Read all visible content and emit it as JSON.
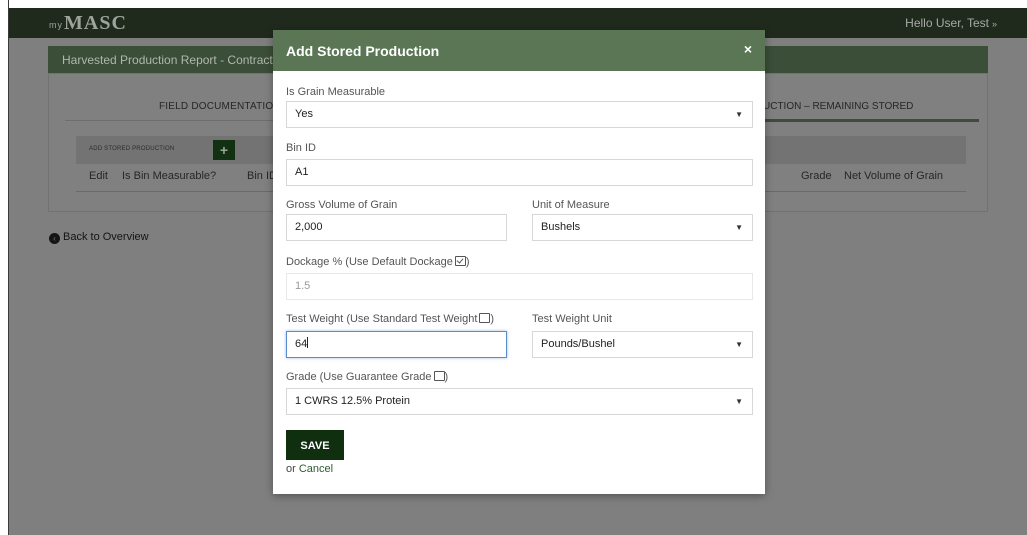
{
  "header": {
    "logo_prefix": "my",
    "logo_text": "MASC",
    "user_greeting": "Hello User, Test",
    "user_caret": "»"
  },
  "report": {
    "title": "Harvested Production Report - Contract F"
  },
  "tabs": {
    "field_documentation": "FIELD DOCUMENTATION",
    "remaining_stored": "UCTION – REMAINING STORED"
  },
  "table": {
    "add_stored_label": "ADD STORED PRODUCTION",
    "add_icon": "+",
    "columns_left": [
      "Edit",
      "Is Bin Measurable?",
      "Bin ID"
    ],
    "columns_right": [
      "Grade",
      "Net Volume of Grain"
    ]
  },
  "back_link": {
    "icon": "‹",
    "label": "Back to Overview"
  },
  "modal": {
    "title": "Add Stored Production",
    "close_icon": "×",
    "is_grain_measurable": {
      "label": "Is Grain Measurable",
      "value": "Yes"
    },
    "bin_id": {
      "label": "Bin ID",
      "value": "A1"
    },
    "gross_volume": {
      "label": "Gross Volume of Grain",
      "value": "2,000"
    },
    "unit_of_measure": {
      "label": "Unit of Measure",
      "value": "Bushels"
    },
    "dockage": {
      "label": "Dockage % (Use Default Dockage",
      "checked": true,
      "label_end": ")",
      "value": "1.5"
    },
    "test_weight": {
      "label": "Test Weight (Use Standard Test Weight",
      "checked": false,
      "label_end": ")",
      "value": "64"
    },
    "test_weight_unit": {
      "label": "Test Weight Unit",
      "value": "Pounds/Bushel"
    },
    "grade": {
      "label": "Grade (Use Guarantee Grade",
      "checked": false,
      "label_end": ")",
      "value": "1 CWRS 12.5% Protein"
    },
    "dropdown_icon": "▼",
    "save_label": "SAVE",
    "or_text": "or ",
    "cancel_label": "Cancel"
  },
  "colors": {
    "modal_header": "#5a7655",
    "save_button": "#0f2f0f",
    "topbar": "#1f2a1d",
    "focus_ring": "#5b8ccd"
  }
}
